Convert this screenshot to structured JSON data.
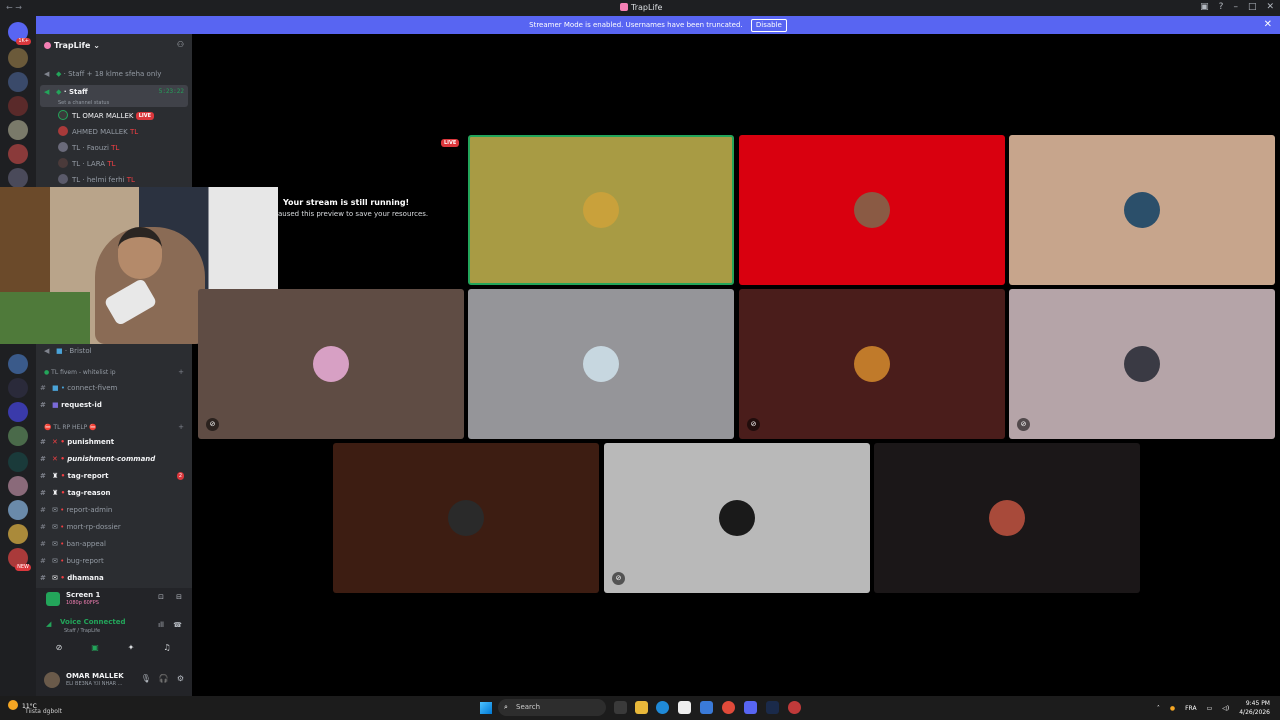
{
  "titlebar": {
    "title": "TrapLife"
  },
  "banner": {
    "text": "Streamer Mode is enabled. Usernames have been truncated.",
    "button": "Disable"
  },
  "serverbar": {
    "top_badge": "1K+",
    "new_label": "NEW"
  },
  "sidebar": {
    "server_name": "TrapLife",
    "channels_top": [
      {
        "label": "Staff + 18 klme sfeha only"
      },
      {
        "label": "Staff",
        "timer": "5:23:22",
        "status": "Set a channel status"
      }
    ],
    "voice_members": [
      {
        "tag": "TL",
        "name": "OMAR MALLEK",
        "live": "LIVE"
      },
      {
        "tag": "",
        "name": "AHMED MALLEK",
        "suffix": "TL"
      },
      {
        "tag": "TL",
        "name": "Faouzi",
        "suffix": "TL"
      },
      {
        "tag": "TL",
        "name": "LARA",
        "suffix": "TL"
      },
      {
        "tag": "TL",
        "name": "helmi ferhi",
        "suffix": "TL"
      }
    ],
    "bristol": "Bristol",
    "category_fivem": "TL fivem - whitelist ip",
    "fivem_channels": [
      "connect-fivem",
      "request-id"
    ],
    "category_help": "TL RP HELP",
    "help_channels": [
      {
        "label": "punishment",
        "bold": true
      },
      {
        "label": "punishment-command",
        "bold": true,
        "italic": true
      },
      {
        "label": "tag-report",
        "bold": true,
        "badge": "2"
      },
      {
        "label": "tag-reason",
        "bold": true
      },
      {
        "label": "report-admin",
        "bold": false
      },
      {
        "label": "mort-rp-dossier",
        "bold": false
      },
      {
        "label": "ban-appeal",
        "bold": false
      },
      {
        "label": "bug-report",
        "bold": false
      },
      {
        "label": "dhamana",
        "bold": true
      }
    ]
  },
  "stream_preview": {
    "title": "Your stream is still running!",
    "subtitle": "aused this preview to save your resources.",
    "live_tag": "LIVE"
  },
  "tiles": [
    {
      "color": "#a89b44",
      "avatar": "#c9a13b",
      "speaking": true,
      "muted": false
    },
    {
      "color": "#d9000f",
      "avatar": "#8a5a44",
      "speaking": false,
      "muted": false
    },
    {
      "color": "#c7a58c",
      "avatar": "#2b4f6a",
      "speaking": false,
      "muted": false
    },
    {
      "color": "#5f4c44",
      "avatar": "#d7a0c4",
      "speaking": false,
      "muted": true
    },
    {
      "color": "#959599",
      "avatar": "#c7d7e0",
      "speaking": false,
      "muted": false
    },
    {
      "color": "#4a1d1b",
      "avatar": "#c07a2a",
      "speaking": false,
      "muted": true
    },
    {
      "color": "#b5a4a8",
      "avatar": "#3a3a44",
      "speaking": false,
      "muted": true
    },
    {
      "color": "#3d1d12",
      "avatar": "#2a2a2a",
      "speaking": false,
      "muted": false
    },
    {
      "color": "#b9b9b9",
      "avatar": "#1a1a1a",
      "speaking": false,
      "muted": true
    },
    {
      "color": "#1b1718",
      "avatar": "#a84a3a",
      "speaking": false,
      "muted": false
    }
  ],
  "userbar": {
    "screen_name": "Screen 1",
    "screen_sub": "1080p 60FPS",
    "voice_status": "Voice Connected",
    "voice_channel": "Staff / TrapLife",
    "username": "OMAR MALLEK",
    "user_status": "ELI BE3NA Y.II NHAR ..."
  },
  "taskbar": {
    "temp": "11°C",
    "weather": "Tiista dgbolt",
    "search": "Search",
    "lang": "FRA",
    "time": "9:45 PM",
    "date": "4/26/2026"
  }
}
